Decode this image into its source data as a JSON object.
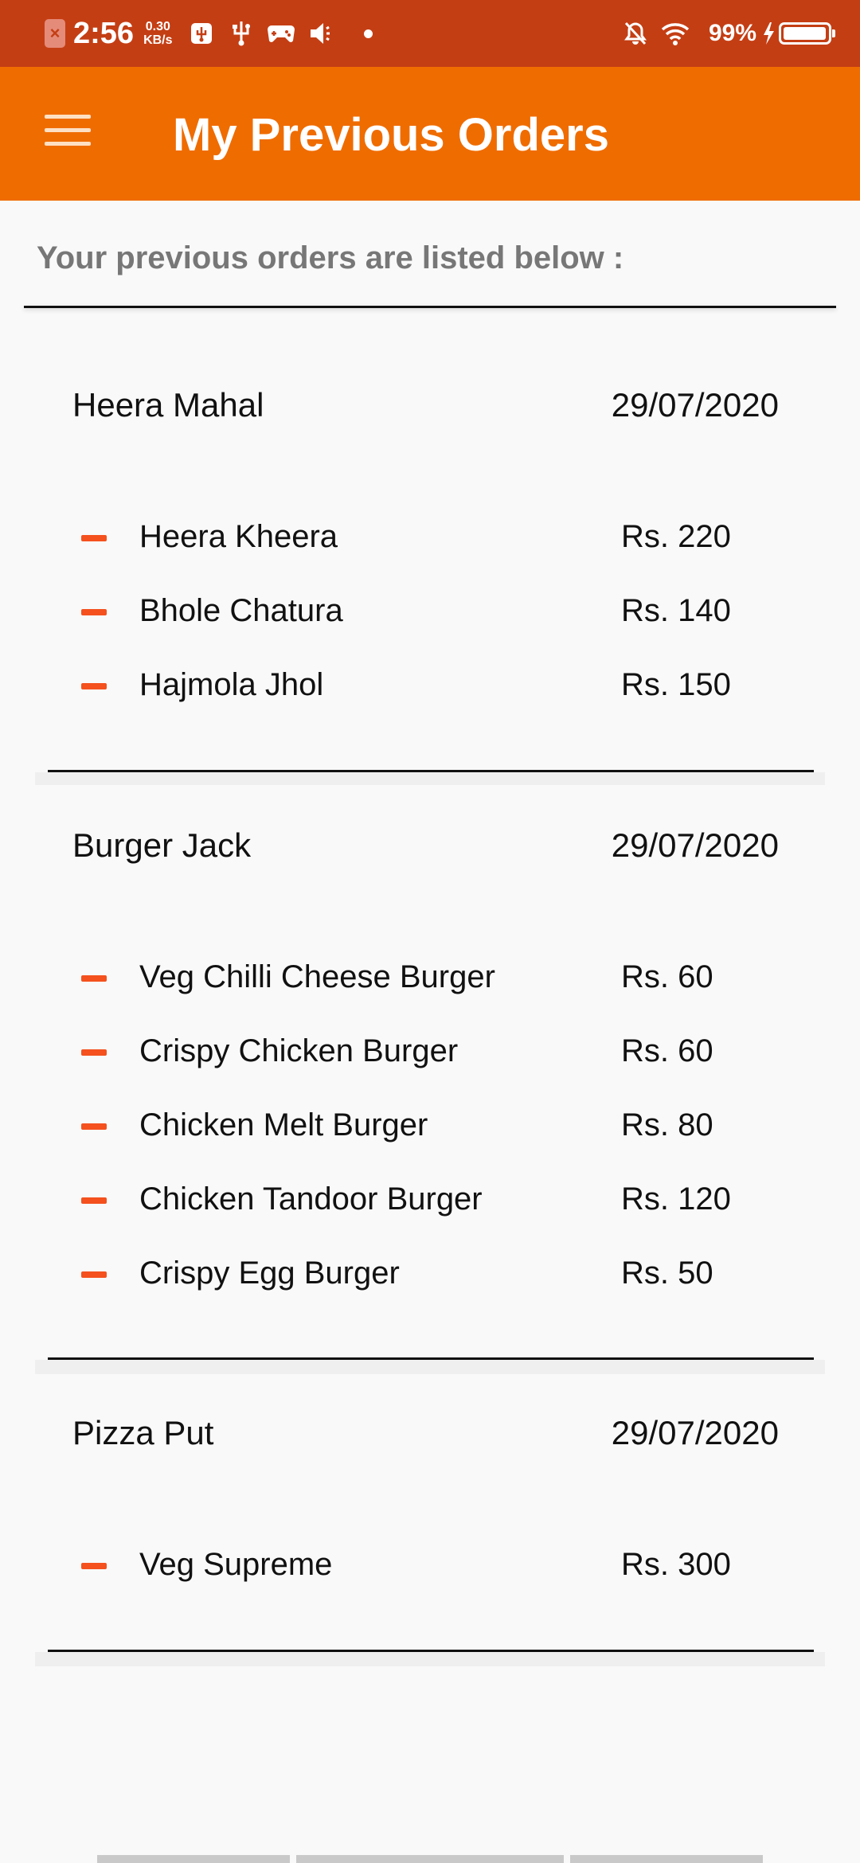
{
  "status_bar": {
    "time": "2:56",
    "speed_value": "0.30",
    "speed_unit": "KB/s",
    "battery": "99%"
  },
  "app_bar": {
    "title": "My Previous Orders",
    "menu_icon": "hamburger-menu-icon"
  },
  "subtitle": "Your previous orders are listed below :",
  "orders": [
    {
      "restaurant": "Heera Mahal",
      "date": "29/07/2020",
      "items": [
        {
          "name": "Heera Kheera",
          "price": "Rs. 220"
        },
        {
          "name": "Bhole Chatura",
          "price": "Rs. 140"
        },
        {
          "name": "Hajmola Jhol",
          "price": "Rs. 150"
        }
      ]
    },
    {
      "restaurant": "Burger Jack",
      "date": "29/07/2020",
      "items": [
        {
          "name": "Veg Chilli Cheese Burger",
          "price": "Rs. 60"
        },
        {
          "name": "Crispy Chicken Burger",
          "price": "Rs. 60"
        },
        {
          "name": "Chicken Melt Burger",
          "price": "Rs. 80"
        },
        {
          "name": "Chicken Tandoor Burger",
          "price": "Rs. 120"
        },
        {
          "name": "Crispy Egg Burger",
          "price": "Rs. 50"
        }
      ]
    },
    {
      "restaurant": "Pizza Put",
      "date": "29/07/2020",
      "items": [
        {
          "name": "Veg Supreme",
          "price": "Rs. 300"
        }
      ]
    }
  ],
  "colors": {
    "status_bar": "#c43e14",
    "app_bar": "#ef6c00",
    "item_dash": "#f4511e"
  }
}
